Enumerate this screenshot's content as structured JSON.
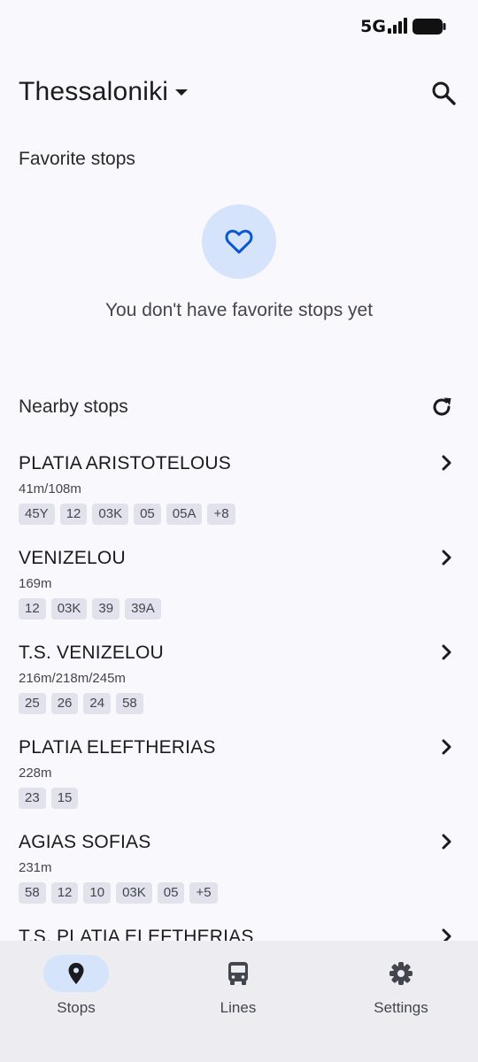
{
  "status_bar": {
    "network": "5G"
  },
  "header": {
    "city": "Thessaloniki"
  },
  "favorites": {
    "title": "Favorite stops",
    "empty_text": "You don't have favorite stops yet"
  },
  "nearby": {
    "title": "Nearby stops",
    "stops": [
      {
        "name": "PLATIA ARISTOTELOUS",
        "distance": "41m/108m",
        "lines": [
          "45Y",
          "12",
          "03K",
          "05",
          "05A",
          "+8"
        ]
      },
      {
        "name": "VENIZELOU",
        "distance": "169m",
        "lines": [
          "12",
          "03K",
          "39",
          "39A"
        ]
      },
      {
        "name": "T.S. VENIZELOU",
        "distance": "216m/218m/245m",
        "lines": [
          "25",
          "26",
          "24",
          "58"
        ]
      },
      {
        "name": "PLATIA ELEFTHERIAS",
        "distance": "228m",
        "lines": [
          "23",
          "15"
        ]
      },
      {
        "name": "AGIAS SOFIAS",
        "distance": "231m",
        "lines": [
          "58",
          "12",
          "10",
          "03K",
          "05",
          "+5"
        ]
      },
      {
        "name": "T.S. PLATIA ELEFTHERIAS",
        "distance": "",
        "lines": []
      }
    ]
  },
  "bottom_nav": {
    "items": [
      {
        "label": "Stops",
        "icon": "location-pin-icon",
        "active": true
      },
      {
        "label": "Lines",
        "icon": "bus-icon",
        "active": false
      },
      {
        "label": "Settings",
        "icon": "gear-icon",
        "active": false
      }
    ]
  },
  "colors": {
    "background": "#f8f8fd",
    "accent": "#0b57d0",
    "accent_container": "#d5e3fb",
    "chip": "#e1e2ec",
    "nav_background": "#ececf1"
  }
}
